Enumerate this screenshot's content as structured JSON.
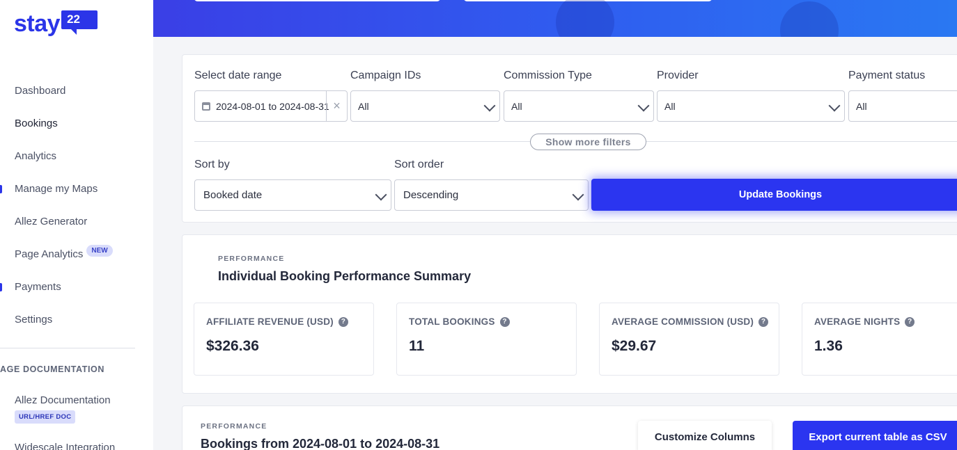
{
  "brand": {
    "word": "stay",
    "badge": "22",
    "color": "#2b35e8"
  },
  "sidebar": {
    "items": [
      {
        "label": "Dashboard"
      },
      {
        "label": "Bookings"
      },
      {
        "label": "Analytics"
      },
      {
        "label": "Manage my Maps"
      },
      {
        "label": "Allez Generator"
      },
      {
        "label": "Page Analytics",
        "badge": "NEW"
      },
      {
        "label": "Payments"
      },
      {
        "label": "Settings"
      }
    ],
    "section_title": "AGE DOCUMENTATION",
    "docs": [
      {
        "label": "Allez Documentation",
        "badge": "URL/HREF DOC"
      },
      {
        "label": "Widescale Integration"
      }
    ]
  },
  "filters": {
    "date_range": {
      "label": "Select date range",
      "value": "2024-08-01 to 2024-08-31",
      "clear": "×"
    },
    "campaign_ids": {
      "label": "Campaign IDs",
      "value": "All"
    },
    "commission_type": {
      "label": "Commission Type",
      "value": "All"
    },
    "provider": {
      "label": "Provider",
      "value": "All"
    },
    "payment_status": {
      "label": "Payment status",
      "value": "All"
    },
    "show_more": "Show more filters",
    "sort_by": {
      "label": "Sort by",
      "value": "Booked date"
    },
    "sort_order": {
      "label": "Sort order",
      "value": "Descending"
    },
    "update_button": "Update Bookings"
  },
  "performance": {
    "eyebrow": "PERFORMANCE",
    "title": "Individual Booking Performance Summary",
    "metrics": [
      {
        "label": "AFFILIATE REVENUE (USD)",
        "value": "$326.36"
      },
      {
        "label": "TOTAL BOOKINGS",
        "value": "11"
      },
      {
        "label": "AVERAGE COMMISSION (USD)",
        "value": "$29.67"
      },
      {
        "label": "AVERAGE NIGHTS",
        "value": "1.36"
      }
    ],
    "help_glyph": "?"
  },
  "bookings": {
    "eyebrow": "PERFORMANCE",
    "title": "Bookings from 2024-08-01 to 2024-08-31",
    "customize_button": "Customize Columns",
    "export_button": "Export current table as CSV"
  },
  "colors": {
    "accent": "#2b35f0",
    "hero_start": "#3a3fe6",
    "hero_end": "#2a78f2"
  }
}
